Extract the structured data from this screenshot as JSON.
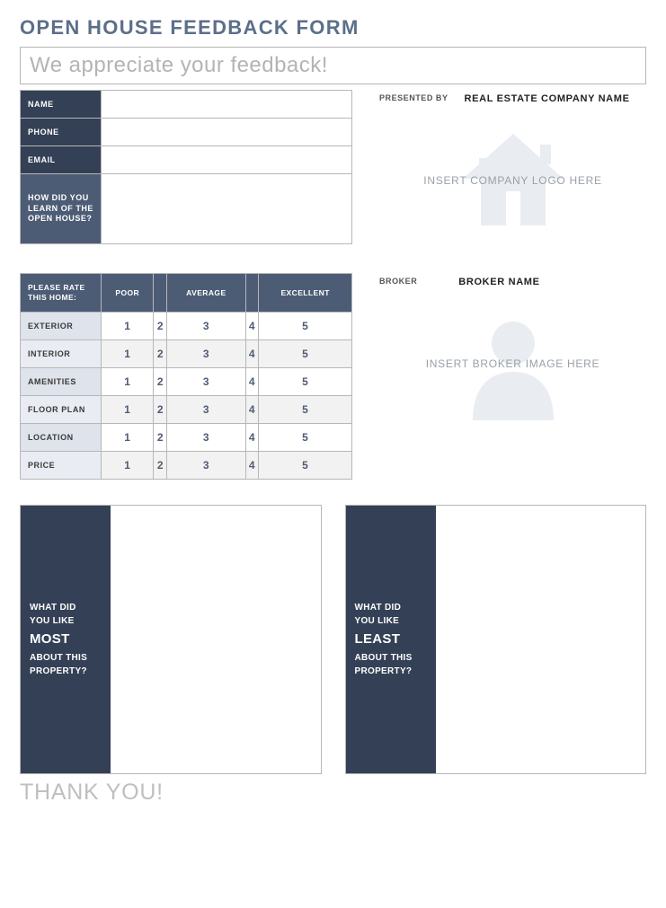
{
  "title": "OPEN HOUSE FEEDBACK FORM",
  "appreciate": "We appreciate your feedback!",
  "contact": {
    "fields": [
      {
        "label": "NAME"
      },
      {
        "label": "PHONE"
      },
      {
        "label": "EMAIL"
      },
      {
        "label": "HOW DID YOU LEARN OF THE OPEN HOUSE?"
      }
    ]
  },
  "presented": {
    "label": "PRESENTED BY",
    "value": "REAL ESTATE COMPANY NAME",
    "logo_placeholder": "INSERT COMPANY LOGO HERE"
  },
  "rating": {
    "header_first": "PLEASE RATE THIS HOME:",
    "scale_labels": [
      "POOR",
      "",
      "AVERAGE",
      "",
      "EXCELLENT"
    ],
    "scale_values": [
      "1",
      "2",
      "3",
      "4",
      "5"
    ],
    "rows": [
      "EXTERIOR",
      "INTERIOR",
      "AMENITIES",
      "FLOOR PLAN",
      "LOCATION",
      "PRICE"
    ]
  },
  "broker": {
    "label": "BROKER",
    "value": "BROKER NAME",
    "image_placeholder": "INSERT BROKER IMAGE HERE"
  },
  "comments": {
    "most": {
      "line1": "WHAT DID",
      "line2": "YOU LIKE",
      "emph": "MOST",
      "line3": "ABOUT THIS",
      "line4": "PROPERTY?"
    },
    "least": {
      "line1": "WHAT DID",
      "line2": "YOU LIKE",
      "emph": "LEAST",
      "line3": "ABOUT THIS",
      "line4": "PROPERTY?"
    }
  },
  "thanks": "THANK YOU!"
}
